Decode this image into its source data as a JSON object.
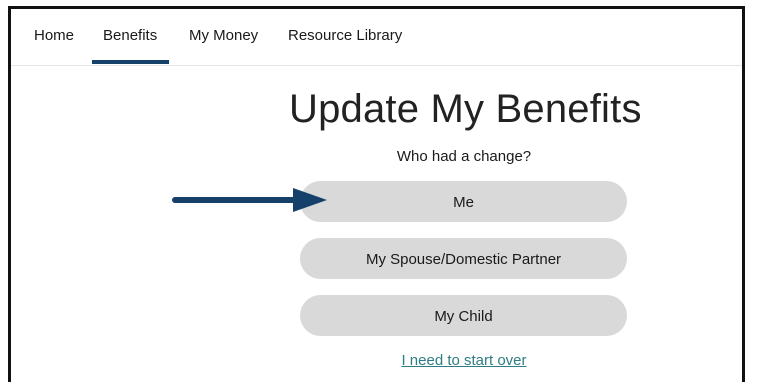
{
  "nav": {
    "items": [
      {
        "label": "Home",
        "active": false
      },
      {
        "label": "Benefits",
        "active": true
      },
      {
        "label": "My Money",
        "active": false
      },
      {
        "label": "Resource Library",
        "active": false
      }
    ]
  },
  "main": {
    "title": "Update My Benefits",
    "prompt": "Who had a change?",
    "options": [
      {
        "label": "Me"
      },
      {
        "label": "My Spouse/Domestic Partner"
      },
      {
        "label": "My Child"
      }
    ],
    "start_over_link": "I need to start over"
  },
  "annotation": {
    "arrow_target": "Me",
    "arrow_color": "#14406a"
  },
  "colors": {
    "nav_active_underline": "#14406a",
    "button_bg": "#d9d9d9",
    "link": "#2e7d84"
  }
}
